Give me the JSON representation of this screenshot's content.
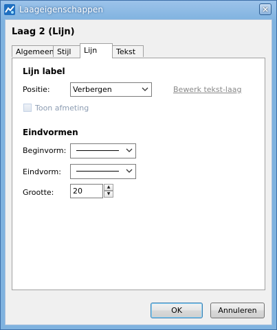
{
  "window": {
    "title": "Laageigenschappen",
    "close_glyph": "✕"
  },
  "heading": "Laag 2 (Lijn)",
  "tabs": [
    {
      "label": "Algemeen",
      "active": false
    },
    {
      "label": "Stijl",
      "active": false
    },
    {
      "label": "Lijn",
      "active": true
    },
    {
      "label": "Tekst",
      "active": false
    }
  ],
  "lijn_label": {
    "section_title": "Lijn label",
    "position_label": "Positie:",
    "position_value": "Verbergen",
    "edit_link": "Bewerk tekst-laag",
    "show_dimension_label": "Toon afmeting",
    "show_dimension_checked": false
  },
  "end_shapes": {
    "section_title": "Eindvormen",
    "start_label": "Beginvorm:",
    "end_label": "Eindvorm:",
    "size_label": "Grootte:",
    "size_value": "20"
  },
  "buttons": {
    "ok": "OK",
    "cancel": "Annuleren"
  },
  "icons": {
    "app": "app-logo-icon",
    "dropdown": "chevron-down-icon"
  }
}
